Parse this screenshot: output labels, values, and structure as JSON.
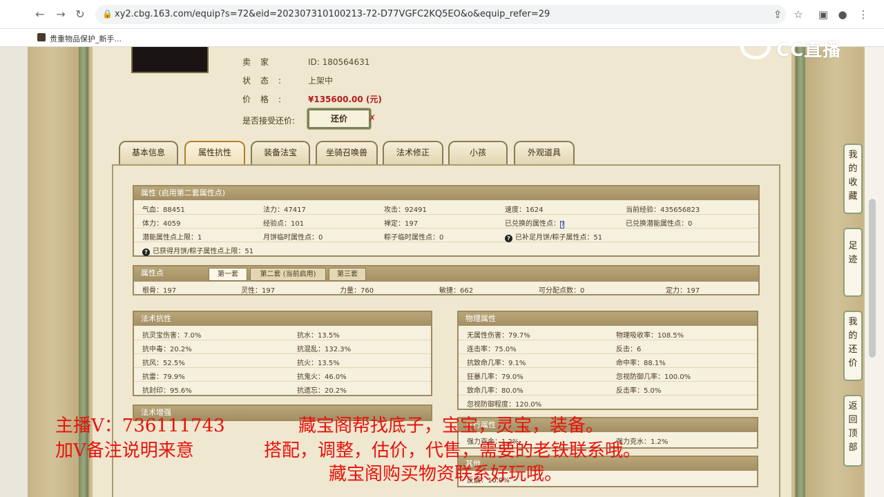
{
  "browser": {
    "url": "xy2.cbg.163.com/equip?s=72&eid=202307310100213-72-D77VGFC2KQ5EO&o&equip_refer=29",
    "bookmark": "贵重物品保护_新手..."
  },
  "seller": {
    "seller_key": "卖家",
    "seller_value": "ID:  180564631",
    "status_key": "状态:",
    "status_value": "上架中",
    "price_key": "价格:",
    "price_value": "¥135600.00 (元)",
    "counter_label": "是否接受还价:",
    "counter_button": "还价",
    "counter_x": "✗"
  },
  "tabs": [
    "基本信息",
    "属性抗性",
    "装备法宝",
    "坐骑召唤兽",
    "法术修正",
    "小孩",
    "外观道具"
  ],
  "attributes": {
    "title": "属性 (启用第二套属性点)",
    "rows": [
      [
        "气血：88451",
        "法力：47417",
        "攻击：92491",
        "速度：1624",
        "当前经验：435656823"
      ],
      [
        "体力：4059",
        "经验点：101",
        "禅定：197",
        "已兑换的属性点：",
        "已兑换潜能属性点：0"
      ],
      [
        "潜能属性点上限：1",
        "月饼临时属性点：0",
        "粽子临时属性点：0",
        "已补足月饼/粽子属性点：51"
      ]
    ],
    "caret_value": "7",
    "last_row": "已获得月饼/粽子属性点上限：51"
  },
  "points": {
    "title": "属性点",
    "subtabs": [
      "第一套",
      "第二套 (当前启用)",
      "第三套"
    ],
    "row": [
      "根骨：197",
      "灵性：197",
      "力量：760",
      "敏捷：662",
      "可分配点数：0",
      "定力：197"
    ]
  },
  "resist": {
    "title": "法术抗性",
    "left": [
      "抗灵宝伤害：7.0%",
      "抗中毒：20.2%",
      "抗风：52.5%",
      "抗雷：79.9%",
      "抗封印：95.6%"
    ],
    "right": [
      "抗水：13.5%",
      "抗混乱：132.3%",
      "抗火：13.5%",
      "抗鬼火：46.0%",
      "抗遗忘：20.2%"
    ]
  },
  "enhance": {
    "title": "法术增强"
  },
  "physical": {
    "title": "物理属性",
    "left": [
      "无属性伤害：79.7%",
      "连击率：75.0%",
      "抗致命几率：9.1%",
      "狂暴几率：79.0%",
      "致命几率：80.0%",
      "忽视防御程度：120.0%"
    ],
    "right": [
      "物理吸收率：108.5%",
      "反击：6",
      "命中率：88.1%",
      "忽视防御几率：100.0%",
      "反击率：5.0%"
    ]
  },
  "five_elements": {
    "title": "五行属性",
    "row": [
      "强力克金：1.2%",
      "强力克水：1.2%"
    ]
  },
  "other": {
    "title": "其他",
    "row": [
      "反震：10.0%"
    ]
  },
  "side_buttons": [
    "我的收藏",
    "足迹",
    "我的还价",
    "返回顶部"
  ],
  "watermark": "CC直播",
  "overlay": {
    "line1a": "主播V：736111743",
    "line1b": "藏宝阁帮找底子，宝宝，灵宝，装备。",
    "line2a": "加V备注说明来意",
    "line2b": "搭配，调整，估价，代售，需要的老铁联系哦。",
    "line3": "藏宝阁购买物资联系好玩哦。"
  }
}
